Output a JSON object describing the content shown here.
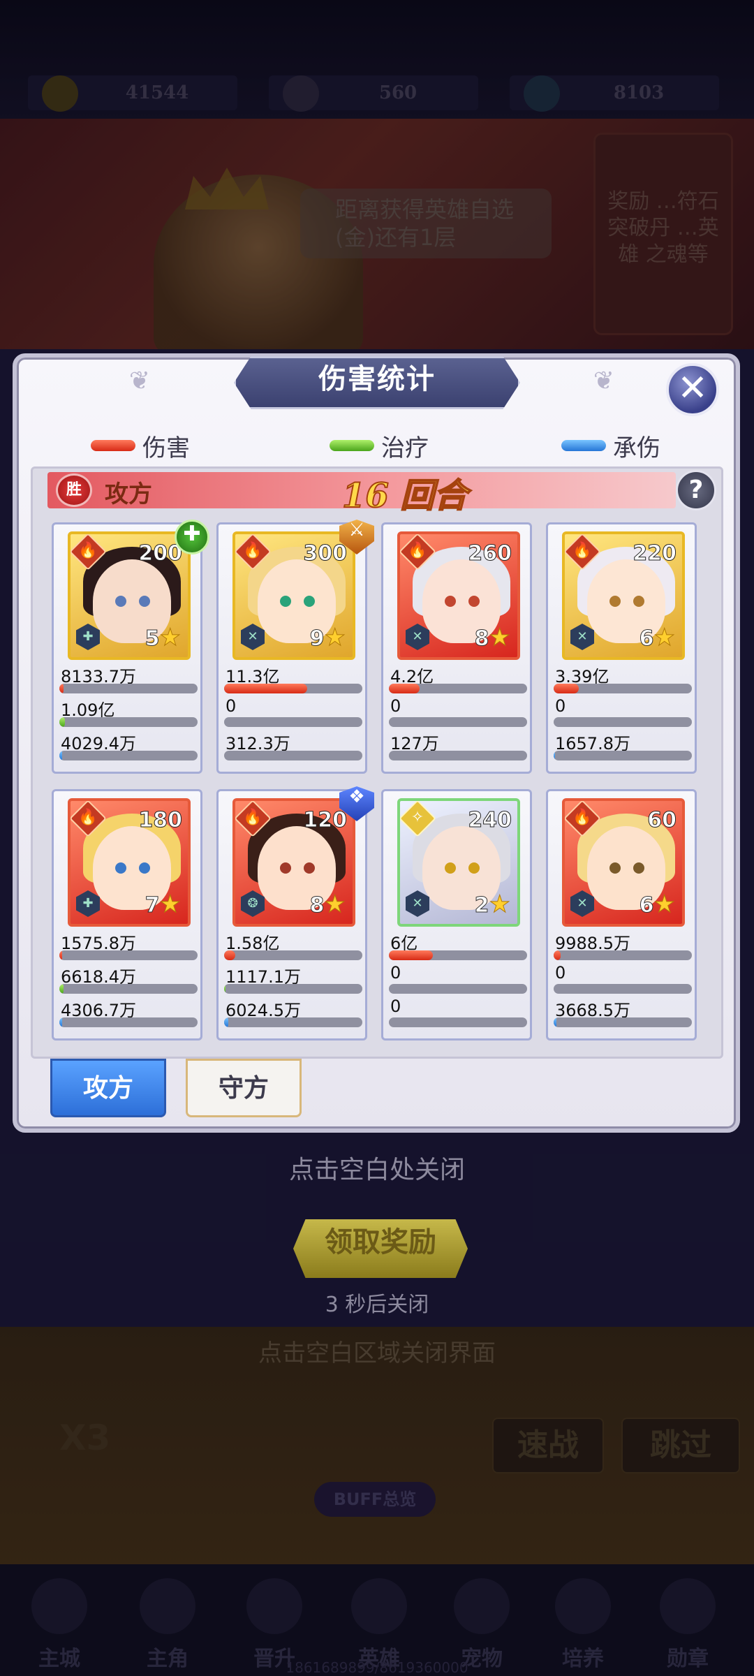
{
  "background": {
    "resources": [
      "41544",
      "560",
      "8103"
    ],
    "bubble_text": "距离获得英雄自选(金)还有1层",
    "panel_text": "奖励 …符石 突破丹 …英雄 之魂等",
    "close_area_hint": "点击空白区域关闭界面",
    "buttons": [
      "速战",
      "跳过"
    ],
    "speed": "X3",
    "buff_label": "BUFF总览",
    "nav": [
      "主城",
      "主角",
      "晋升",
      "英雄",
      "宠物",
      "培养",
      "勋章"
    ],
    "footer": "1861689899/8619360000"
  },
  "dialog": {
    "title": "伤害统计",
    "close_label": "✕",
    "legend": {
      "damage": "伤害",
      "heal": "治疗",
      "tank": "承伤"
    },
    "win_badge": "胜",
    "team_label": "攻方",
    "round_label": "16 回合",
    "help_label": "?",
    "tabs": {
      "attack": "攻方",
      "defense": "守方"
    }
  },
  "heroes": [
    {
      "level": "200",
      "stars": "5",
      "damage": "8133.7万",
      "heal": "1.09亿",
      "tank": "4029.4万",
      "damage_pct": 3,
      "heal_pct": 4,
      "tank_pct": 2
    },
    {
      "level": "300",
      "stars": "9",
      "damage": "11.3亿",
      "heal": "0",
      "tank": "312.3万",
      "damage_pct": 60,
      "heal_pct": 0,
      "tank_pct": 0
    },
    {
      "level": "260",
      "stars": "8",
      "damage": "4.2亿",
      "heal": "0",
      "tank": "127万",
      "damage_pct": 22,
      "heal_pct": 0,
      "tank_pct": 0
    },
    {
      "level": "220",
      "stars": "6",
      "damage": "3.39亿",
      "heal": "0",
      "tank": "1657.8万",
      "damage_pct": 18,
      "heal_pct": 0,
      "tank_pct": 1
    },
    {
      "level": "180",
      "stars": "7",
      "damage": "1575.8万",
      "heal": "6618.4万",
      "tank": "4306.7万",
      "damage_pct": 1,
      "heal_pct": 3,
      "tank_pct": 2
    },
    {
      "level": "120",
      "stars": "8",
      "damage": "1.58亿",
      "heal": "1117.1万",
      "tank": "6024.5万",
      "damage_pct": 8,
      "heal_pct": 1,
      "tank_pct": 3
    },
    {
      "level": "240",
      "stars": "2",
      "damage": "6亿",
      "heal": "0",
      "tank": "0",
      "damage_pct": 32,
      "heal_pct": 0,
      "tank_pct": 0
    },
    {
      "level": "60",
      "stars": "6",
      "damage": "9988.5万",
      "heal": "0",
      "tank": "3668.5万",
      "damage_pct": 5,
      "heal_pct": 0,
      "tank_pct": 2
    }
  ],
  "footer": {
    "close_hint": "点击空白处关闭",
    "reward_button": "领取奖励",
    "countdown": "3  秒后关闭"
  }
}
